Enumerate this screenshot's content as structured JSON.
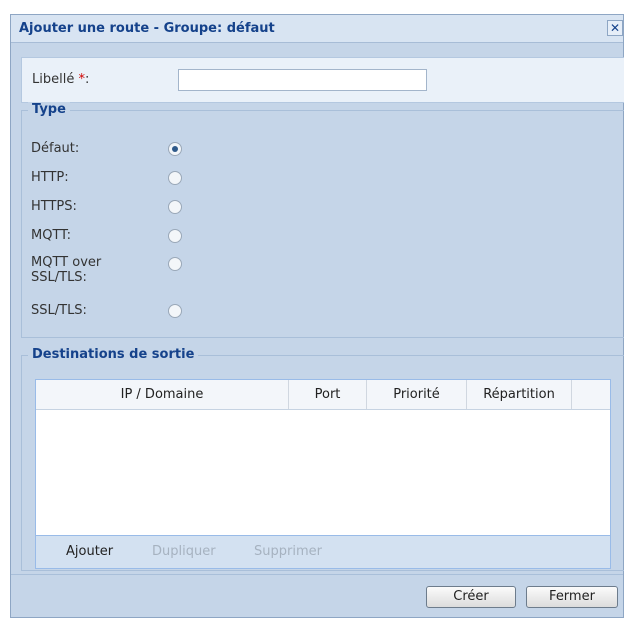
{
  "dialog": {
    "title": "Ajouter une route - Groupe: défaut",
    "close_glyph": "✕"
  },
  "form": {
    "label_field": {
      "label": "Libellé ",
      "required_mark": "*",
      "suffix": ":",
      "value": ""
    }
  },
  "type_section": {
    "legend": "Type",
    "options": [
      {
        "label": "Défaut:",
        "checked": true
      },
      {
        "label": "HTTP:",
        "checked": false
      },
      {
        "label": "HTTPS:",
        "checked": false
      },
      {
        "label": "MQTT:",
        "checked": false
      },
      {
        "label": "MQTT over SSL/TLS:",
        "line1": "MQTT over",
        "line2": "SSL/TLS:",
        "checked": false
      },
      {
        "label": "SSL/TLS:",
        "checked": false
      }
    ]
  },
  "destinations": {
    "legend": "Destinations de sortie",
    "columns": [
      "IP / Domaine",
      "Port",
      "Priorité",
      "Répartition"
    ],
    "rows": [],
    "toolbar": {
      "add": "Ajouter",
      "duplicate": "Dupliquer",
      "delete": "Supprimer"
    }
  },
  "footer": {
    "create": "Créer",
    "close": "Fermer"
  },
  "icons": {
    "close": "close-icon"
  }
}
